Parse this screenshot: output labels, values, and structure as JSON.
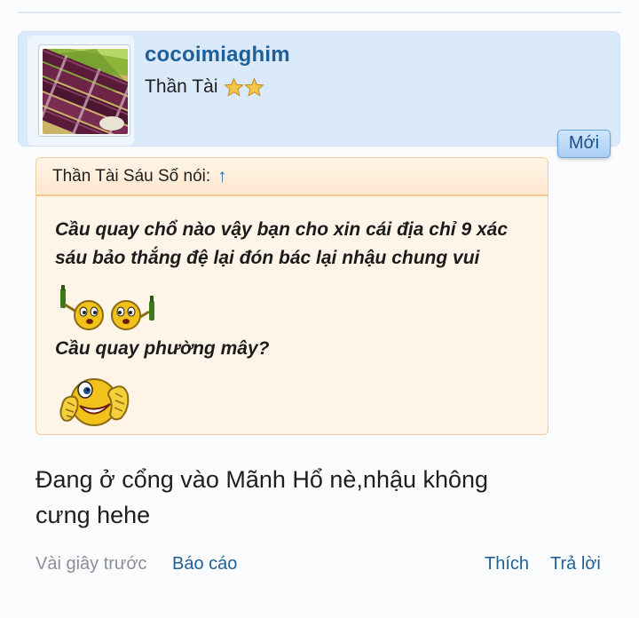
{
  "post": {
    "username": "cocoimiaghim",
    "user_title": "Thần Tài",
    "new_badge": "Mới",
    "avatar_icon": "sugarcane-avatar-icon",
    "rank_stars": 2,
    "quote": {
      "header": "Thần Tài Sáu Số nói:",
      "arrow": "↑",
      "line1": "Cầu quay chổ nào vậy bạn cho xin cái địa chỉ 9 xác",
      "line2": "sáu bảo thắng đệ lại đón bác lại nhậu chung vui",
      "line3": "Cầu quay phường mây?",
      "smileys": [
        "drinking-smiley-icon",
        "shy-smiley-icon"
      ]
    },
    "message_line1": "Đang ở cổng vào Mãnh Hổ nè,nhậu không",
    "message_line2": "cưng hehe",
    "footer": {
      "timestamp": "Vài giây trước",
      "report": "Báo cáo",
      "like": "Thích",
      "reply": "Trả lời"
    }
  },
  "colors": {
    "accent": "#1f5f98",
    "user_bar_bg": "#dbeafa",
    "quote_bg": "#fff4e8",
    "quote_border": "#f3cc9e"
  }
}
